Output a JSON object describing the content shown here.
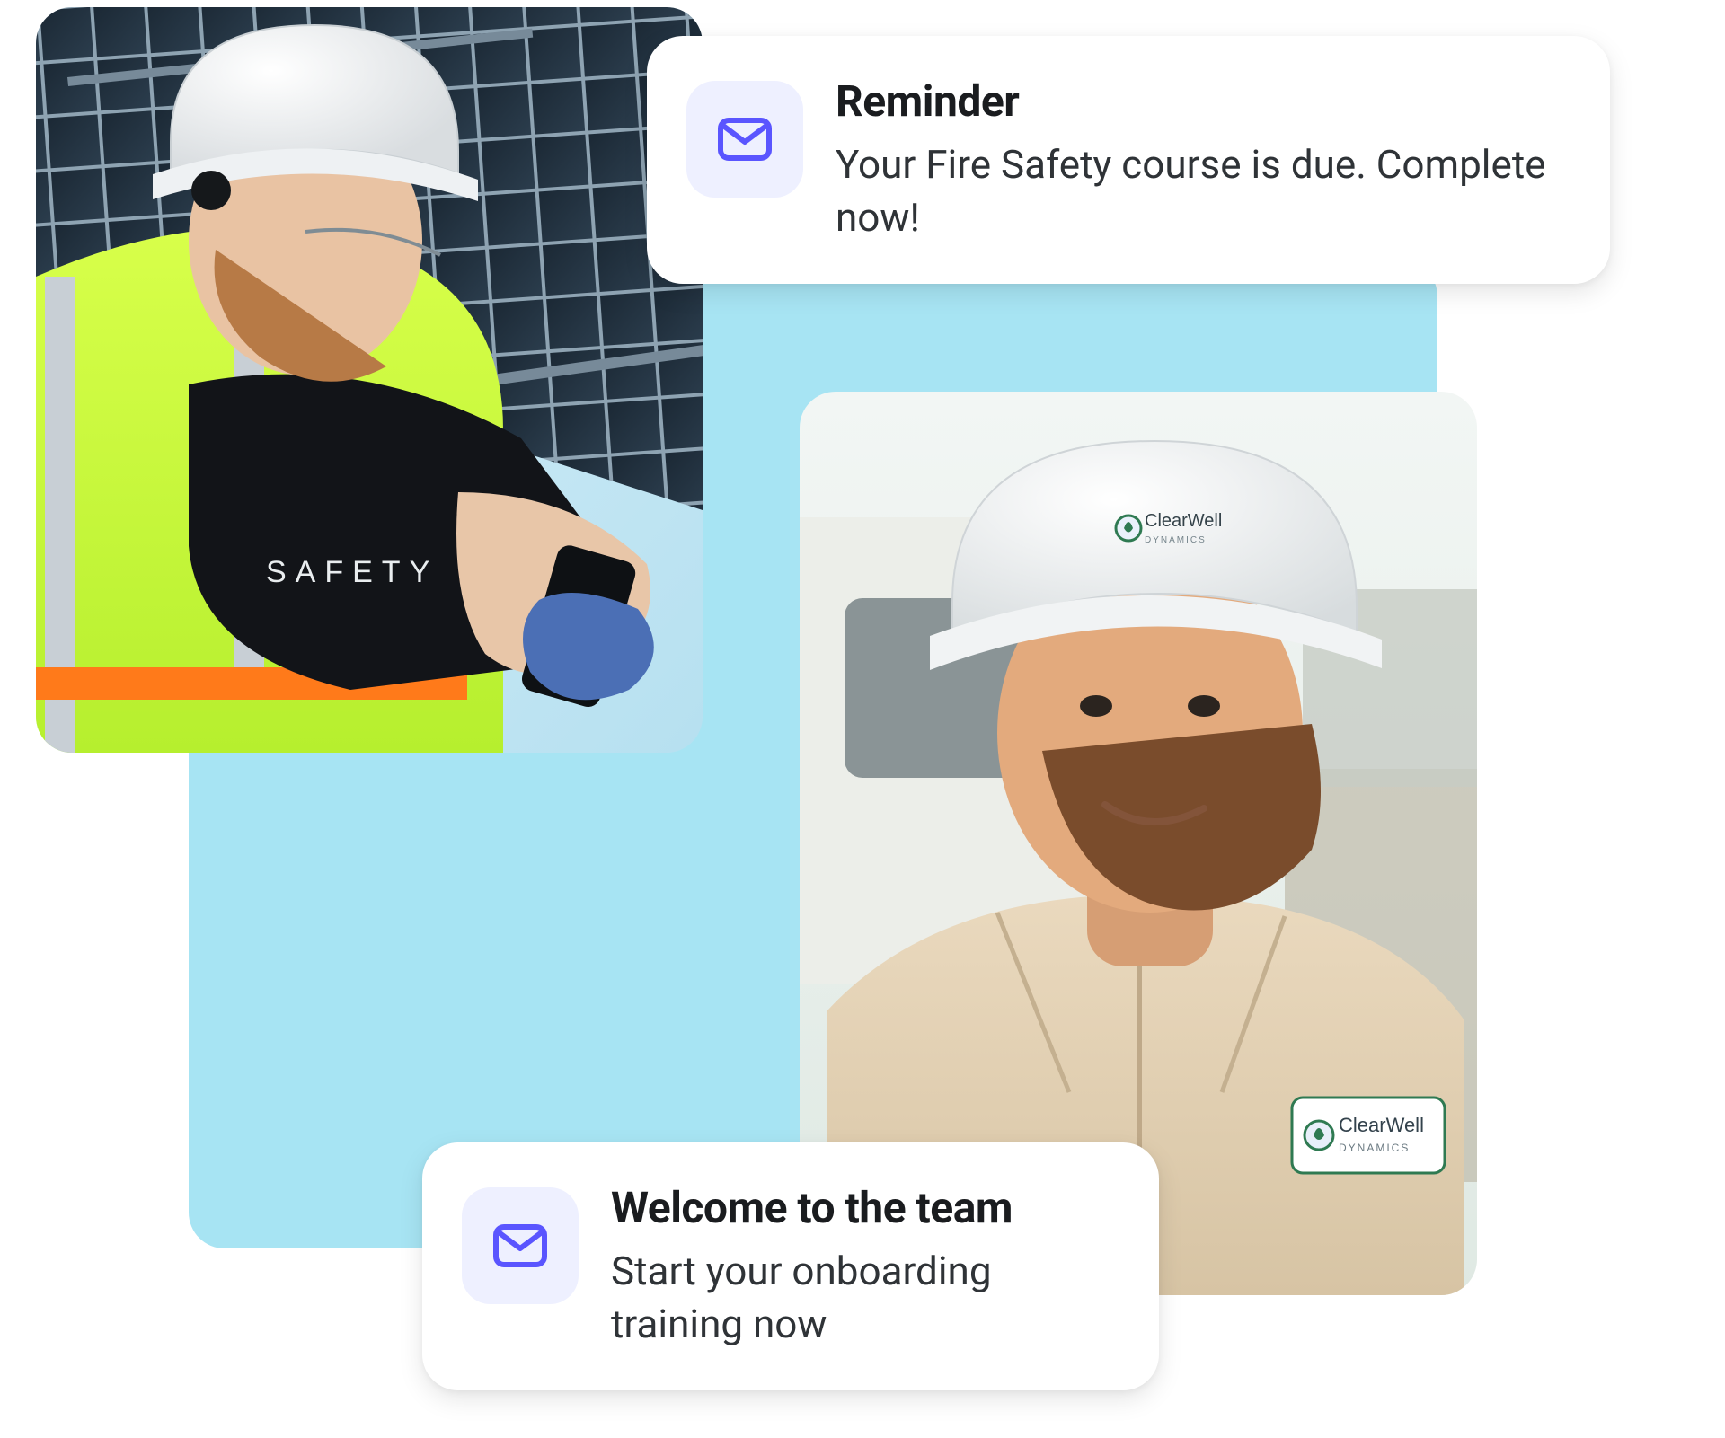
{
  "colors": {
    "sky": "#a7e4f3",
    "icon_tile_bg": "#eef0ff",
    "icon_stroke": "#5a55ff",
    "card_bg": "#ffffff",
    "text_primary": "#1a1c1f",
    "text_body": "#2f3337"
  },
  "photos": {
    "left": {
      "caption": "Worker in safety vest and white hard hat using a phone under solar panels",
      "shirt_label": "SAFETY"
    },
    "right": {
      "caption": "Smiling bearded field worker in white hard hat and tan work shirt",
      "company_name": "ClearWell",
      "company_tagline": "DYNAMICS"
    }
  },
  "notifications": {
    "top": {
      "title": "Reminder",
      "text": "Your Fire Safety course is due. Complete now!",
      "icon": "mail-icon"
    },
    "bottom": {
      "title": "Welcome to the team",
      "text": "Start your onboarding training now",
      "icon": "mail-icon"
    }
  }
}
